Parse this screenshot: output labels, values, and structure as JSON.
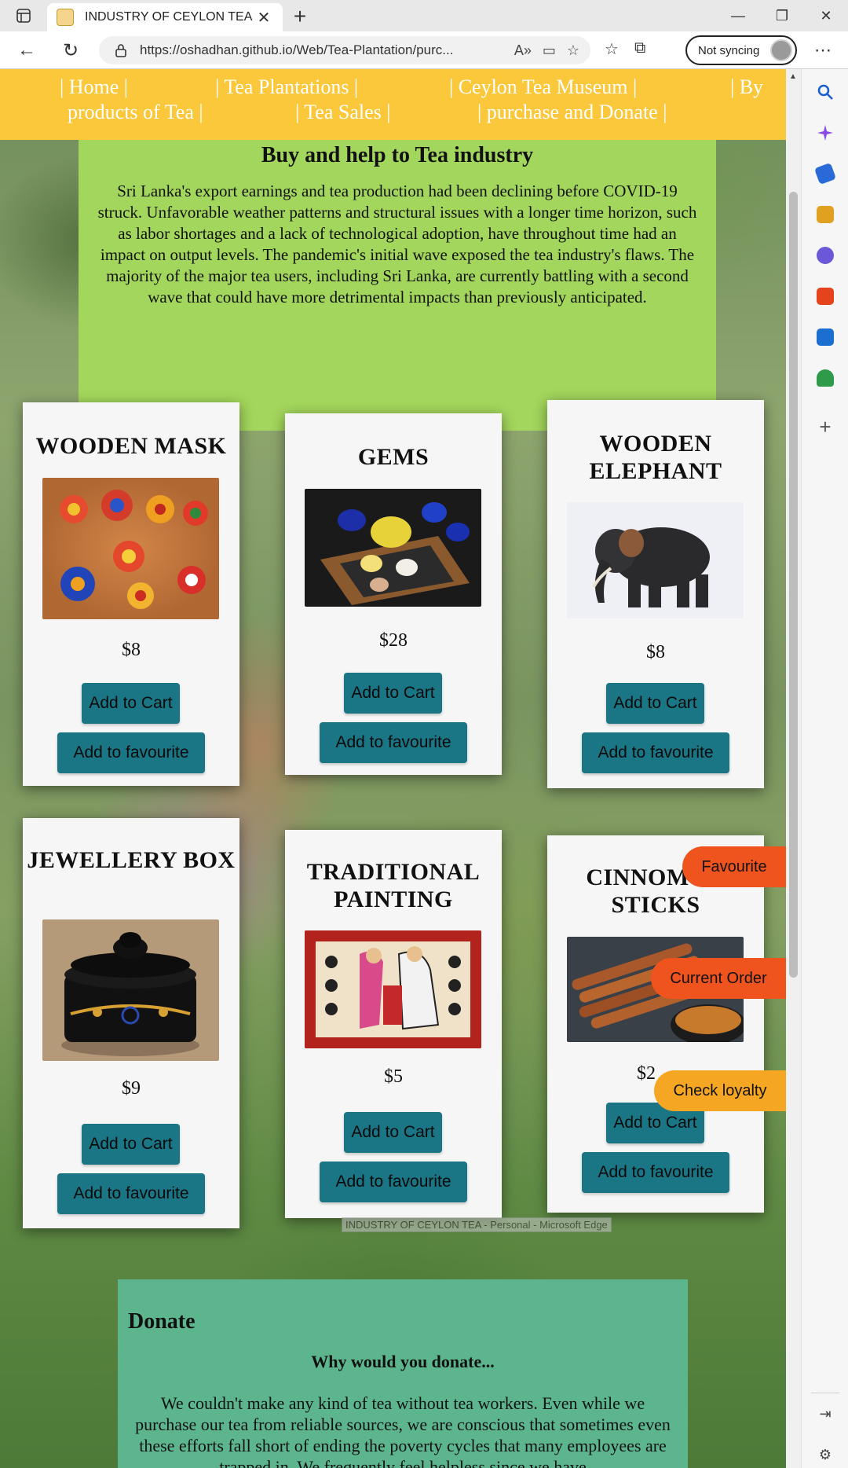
{
  "browser": {
    "tab_title": "INDUSTRY OF CEYLON TEA",
    "url": "https://oshadhan.github.io/Web/Tea-Plantation/purc...",
    "sync_label": "Not syncing",
    "window_tooltip": "INDUSTRY OF CEYLON TEA - Personal - Microsoft Edge"
  },
  "nav": {
    "items": [
      {
        "label": "| Home |"
      },
      {
        "label": "| Tea Plantations |"
      },
      {
        "label": "| Ceylon Tea Museum |"
      },
      {
        "label": "| By"
      },
      {
        "label": "products of Tea |"
      },
      {
        "label": "| Tea Sales |"
      },
      {
        "label": "| purchase and Donate |"
      }
    ]
  },
  "intro": {
    "title": "Buy and help to Tea industry",
    "body": "Sri Lanka's export earnings and tea production had been declining before COVID-19 struck. Unfavorable weather patterns and structural issues with a longer time horizon, such as labor shortages and a lack of technological adoption, have throughout time had an impact on output levels. The pandemic's initial wave exposed the tea industry's flaws. The majority of the major tea users, including Sri Lanka, are currently battling with a second wave that could have more detrimental impacts than previously anticipated."
  },
  "products": [
    {
      "title": "WOODEN MASK",
      "price": "$8",
      "cart_label": "Add to Cart",
      "fav_label": "Add to favourite"
    },
    {
      "title": "GEMS",
      "price": "$28",
      "cart_label": "Add to Cart",
      "fav_label": "Add to favourite"
    },
    {
      "title": "WOODEN ELEPHANT",
      "price": "$8",
      "cart_label": "Add to Cart",
      "fav_label": "Add to favourite"
    },
    {
      "title": "JEWELLERY BOX",
      "price": "$9",
      "cart_label": "Add to Cart",
      "fav_label": "Add to favourite"
    },
    {
      "title": "TRADITIONAL PAINTING",
      "price": "$5",
      "cart_label": "Add to Cart",
      "fav_label": "Add to favourite"
    },
    {
      "title": "CINNOMON STICKS",
      "price": "$2",
      "cart_label": "Add to Cart",
      "fav_label": "Add to favourite"
    }
  ],
  "floating": {
    "favourite": "Favourite",
    "current_order": "Current Order",
    "check_loyalty": "Check loyalty"
  },
  "donate": {
    "title": "Donate",
    "subtitle": "Why would you donate...",
    "body": "We couldn't make any kind of tea without tea workers. Even while we purchase our tea from reliable sources, we are conscious that sometimes even these efforts fall short of ending the poverty cycles that many employees are trapped in. We frequently feel helpless since we have"
  },
  "colors": {
    "nav_bg": "#fbc83b",
    "intro_bg": "#a3d65c",
    "button_bg": "#1a7585",
    "donate_bg": "#5db58e",
    "favourite_btn": "#f0541e",
    "current_order_btn": "#f0541e",
    "loyalty_btn": "#f5a623"
  }
}
